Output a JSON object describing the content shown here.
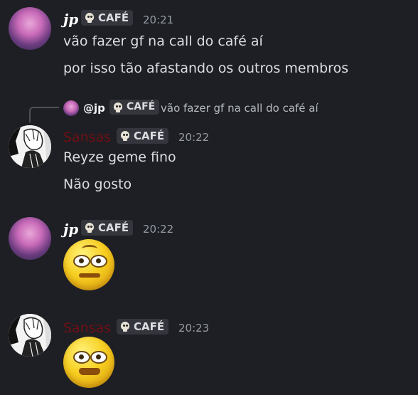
{
  "messages": [
    {
      "author": "jp",
      "tag": "CAFÉ",
      "time": "20:21",
      "lines": [
        "vão fazer gf na call do café aí",
        "por isso tão afastando os outros membros"
      ]
    },
    {
      "author": "Sansas",
      "tag": "CAFÉ",
      "time": "20:22",
      "reply": {
        "author": "@jp",
        "tag": "CAFÉ",
        "text": "vão fazer gf na call do café aí"
      },
      "lines": [
        "Reyze geme fino",
        "Não gosto"
      ]
    },
    {
      "author": "jp",
      "tag": "CAFÉ",
      "time": "20:22",
      "emoji": "raised-eyebrow-emoji"
    },
    {
      "author": "Sansas",
      "tag": "CAFÉ",
      "time": "20:23",
      "emoji": "goofy-face-emoji"
    }
  ],
  "colors": {
    "background": "#1e1f24",
    "sansas_name": "#6e0f14",
    "text": "#dbdee1",
    "timestamp": "#949ba4"
  }
}
